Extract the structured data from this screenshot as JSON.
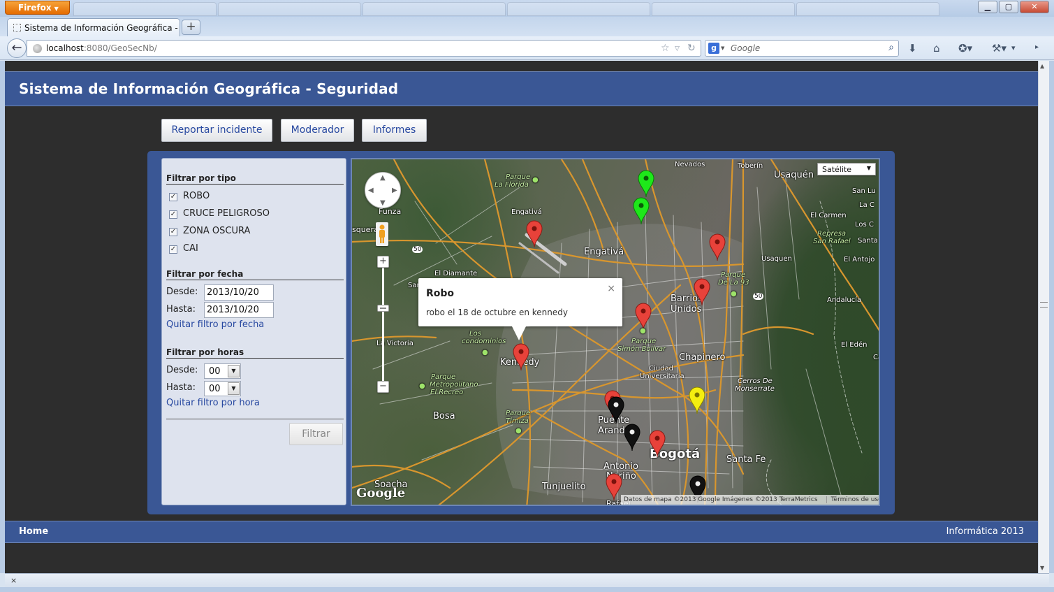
{
  "browser": {
    "menu_button": "Firefox",
    "tab_title": "Sistema de Información Geográfica - Se...",
    "url_host": "localhost",
    "url_rest": ":8080/GeoSecNb/",
    "search_placeholder": "Google",
    "window_controls": [
      "minimize-icon",
      "maximize-icon",
      "close-icon"
    ]
  },
  "header": {
    "title": "Sistema de Información Geográfica - Seguridad"
  },
  "nav": {
    "reportar": "Reportar incidente",
    "moderador": "Moderador",
    "informes": "Informes"
  },
  "filters": {
    "tipo_title": "Filtrar por tipo",
    "tipos": [
      {
        "label": "ROBO",
        "checked": true
      },
      {
        "label": "CRUCE PELIGROSO",
        "checked": true
      },
      {
        "label": "ZONA OSCURA",
        "checked": true
      },
      {
        "label": "CAI",
        "checked": true
      }
    ],
    "fecha_title": "Filtrar por fecha",
    "desde_label": "Desde:",
    "hasta_label": "Hasta:",
    "fecha_desde": "2013/10/20",
    "fecha_hasta": "2013/10/20",
    "quitar_fecha": "Quitar filtro por fecha",
    "horas_title": "Filtrar por horas",
    "hora_desde": "00",
    "hora_hasta": "00",
    "quitar_hora": "Quitar filtro por hora",
    "filtrar_button": "Filtrar"
  },
  "map": {
    "map_type": "Satélite",
    "infowindow": {
      "title": "Robo",
      "text": "robo el 18 de octubre en kennedy",
      "close": "×"
    },
    "attribution": "Datos de mapa ©2013 Google Imágenes ©2013 TerraMetrics",
    "terms": "Términos de uso",
    "logo": "Google",
    "labels": {
      "nevados": "Nevados",
      "toberin": "Toberín",
      "usaquen_big": "Usaquén",
      "san_lu": "San Lu",
      "la_c": "La C",
      "el_carmen": "El Carmen",
      "los_c": "Los C",
      "represa": "Represa",
      "san_rafael": "San Rafael",
      "santa": "Santa",
      "usaquen_small": "Usaquen",
      "el_antojo": "El Antojo",
      "parque_la_florida_1": "Parque",
      "parque_la_florida_2": "La Florida",
      "engativa_small": "Engativá",
      "funza": "Funza",
      "mosquera": "squera",
      "engativa_big": "Engativá",
      "el_diamante": "El Diamante",
      "san": "San",
      "parque_de_la_93_1": "Parque",
      "parque_de_la_93_2": "De La 93",
      "barrios_1": "Barrios",
      "barrios_2": "Unidos",
      "andalucia": "Andalucía",
      "la_victoria": "La Victoria",
      "los_condominios_1": "Los",
      "los_condominios_2": "condominios",
      "parque_simon_1": "Parque",
      "parque_simon_2": "Simón Bolívar",
      "chapinero": "Chapinero",
      "el_eden": "El Edén",
      "ca": "Ca",
      "kennedy": "Kennedy",
      "ciudad_1": "Ciudad",
      "ciudad_2": "Universitaria",
      "parque_metro_1": "Parque",
      "parque_metro_2": "Metropolitano",
      "parque_metro_3": "El Recreo",
      "cerros_1": "Cerros De",
      "cerros_2": "Monserrate",
      "bosa": "Bosa",
      "parque_timiza_1": "Parque",
      "parque_timiza_2": "Timiza",
      "puente_1": "Puente",
      "puente_2": "Aranda",
      "bogota": "Bogotá",
      "santa_fe": "Santa Fe",
      "antonio_1": "Antonio",
      "antonio_2": "Nariño",
      "soacha": "Soacha",
      "tunjuelito": "Tunjuelito",
      "rafael": "Rafael",
      "shield_50a": "50",
      "shield_50b": "50"
    },
    "markers": [
      {
        "type": "robo",
        "color": "#e8423a"
      },
      {
        "type": "cruce_peligroso",
        "color": "#1ee81a"
      },
      {
        "type": "zona_oscura",
        "color": "#111111"
      },
      {
        "type": "cai",
        "color": "#f5ee10"
      }
    ]
  },
  "footer": {
    "home": "Home",
    "right": "Informática 2013"
  },
  "statusbar": {
    "close": "×"
  }
}
